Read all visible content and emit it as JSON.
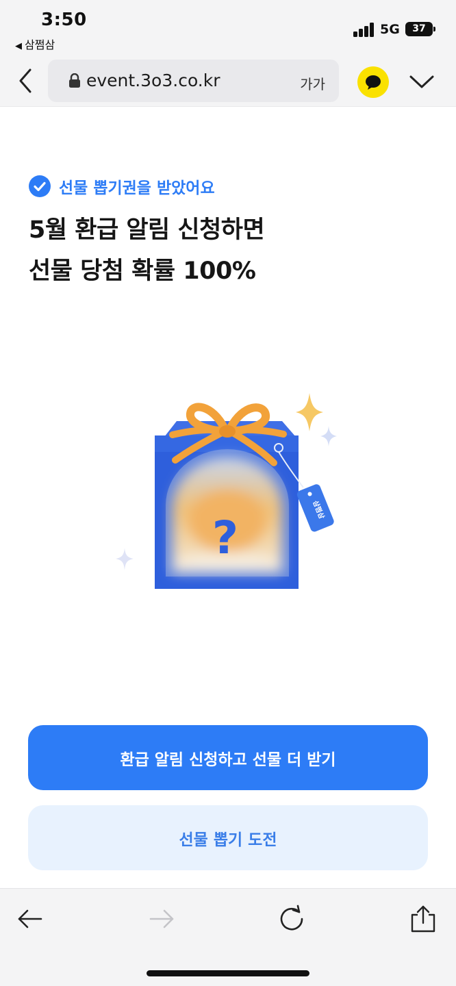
{
  "status_bar": {
    "time": "3:50",
    "back_app": "삼쩜삼",
    "network": "5G",
    "battery": "37"
  },
  "browser": {
    "url": "event.3o3.co.kr",
    "text_size_label": "가가"
  },
  "content": {
    "badge": "선물 뽑기권을 받았어요",
    "headline_line1": "5월 환급 알림 신청하면",
    "headline_line2": "선물 당첨 확률 100%",
    "gift_box": {
      "mystery_mark": "?",
      "tag_text": "삼쩜삼"
    },
    "primary_button": "환급 알림 신청하고 선물 더 받기",
    "secondary_button": "선물 뽑기 도전"
  },
  "colors": {
    "accent": "#2d7cf6",
    "secondary_bg": "#e8f2fe",
    "kakao": "#fae100",
    "box_blue": "#2e5fdc",
    "ribbon": "#f2a23a"
  },
  "icons": {
    "nav_back": "chevron-left-icon",
    "lock": "lock-icon",
    "kakao": "kakao-chat-icon",
    "menu": "chevron-down-icon",
    "check": "check-circle-icon",
    "toolbar": [
      "arrow-left-icon",
      "arrow-right-icon",
      "refresh-icon",
      "share-icon"
    ]
  }
}
